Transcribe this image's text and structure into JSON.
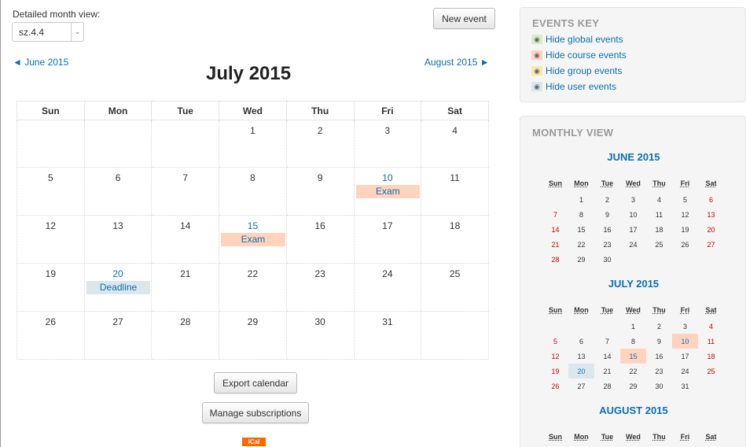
{
  "header": {
    "detailed_label": "Detailed month view:",
    "course_select": "sz.4.4",
    "new_event": "New event",
    "prev_month": "◄ June 2015",
    "next_month": "August 2015 ►",
    "month_title": "July 2015"
  },
  "calendar": {
    "weekdays": [
      "Sun",
      "Mon",
      "Tue",
      "Wed",
      "Thu",
      "Fri",
      "Sat"
    ],
    "weeks": [
      [
        null,
        null,
        null,
        {
          "d": "1"
        },
        {
          "d": "2"
        },
        {
          "d": "3"
        },
        {
          "d": "4"
        }
      ],
      [
        {
          "d": "5"
        },
        {
          "d": "6"
        },
        {
          "d": "7"
        },
        {
          "d": "8"
        },
        {
          "d": "9"
        },
        {
          "d": "10",
          "event": "Exam",
          "type": "course"
        },
        {
          "d": "11"
        }
      ],
      [
        {
          "d": "12"
        },
        {
          "d": "13"
        },
        {
          "d": "14"
        },
        {
          "d": "15",
          "event": "Exam",
          "type": "course"
        },
        {
          "d": "16"
        },
        {
          "d": "17"
        },
        {
          "d": "18"
        }
      ],
      [
        {
          "d": "19"
        },
        {
          "d": "20",
          "event": "Deadline",
          "type": "user"
        },
        {
          "d": "21"
        },
        {
          "d": "22"
        },
        {
          "d": "23"
        },
        {
          "d": "24"
        },
        {
          "d": "25"
        }
      ],
      [
        {
          "d": "26"
        },
        {
          "d": "27"
        },
        {
          "d": "28"
        },
        {
          "d": "29"
        },
        {
          "d": "30"
        },
        {
          "d": "31"
        },
        null
      ]
    ]
  },
  "footer": {
    "export": "Export calendar",
    "manage": "Manage subscriptions",
    "ical": "iCal"
  },
  "events_key": {
    "title": "EVENTS KEY",
    "items": [
      {
        "label": "Hide global events",
        "color": "#d6f0c6"
      },
      {
        "label": "Hide course events",
        "color": "#ffd3bd"
      },
      {
        "label": "Hide group events",
        "color": "#fee7ae"
      },
      {
        "label": "Hide user events",
        "color": "#dce7ec"
      }
    ]
  },
  "monthly_view": {
    "title": "MONTHLY VIEW",
    "weekdays": [
      "Sun",
      "Mon",
      "Tue",
      "Wed",
      "Thu",
      "Fri",
      "Sat"
    ],
    "months": [
      {
        "name": "JUNE 2015",
        "weeks": [
          [
            "",
            "1",
            "2",
            "3",
            "4",
            "5",
            "6"
          ],
          [
            "7",
            "8",
            "9",
            "10",
            "11",
            "12",
            "13"
          ],
          [
            "14",
            "15",
            "16",
            "17",
            "18",
            "19",
            "20"
          ],
          [
            "21",
            "22",
            "23",
            "24",
            "25",
            "26",
            "27"
          ],
          [
            "28",
            "29",
            "30",
            "",
            "",
            "",
            ""
          ]
        ],
        "events": {}
      },
      {
        "name": "JULY 2015",
        "weeks": [
          [
            "",
            "",
            "",
            "1",
            "2",
            "3",
            "4"
          ],
          [
            "5",
            "6",
            "7",
            "8",
            "9",
            "10",
            "11"
          ],
          [
            "12",
            "13",
            "14",
            "15",
            "16",
            "17",
            "18"
          ],
          [
            "19",
            "20",
            "21",
            "22",
            "23",
            "24",
            "25"
          ],
          [
            "26",
            "27",
            "28",
            "29",
            "30",
            "31",
            ""
          ]
        ],
        "events": {
          "10": "course",
          "15": "course",
          "20": "user"
        }
      },
      {
        "name": "AUGUST 2015",
        "weeks": [],
        "events": {}
      }
    ]
  }
}
